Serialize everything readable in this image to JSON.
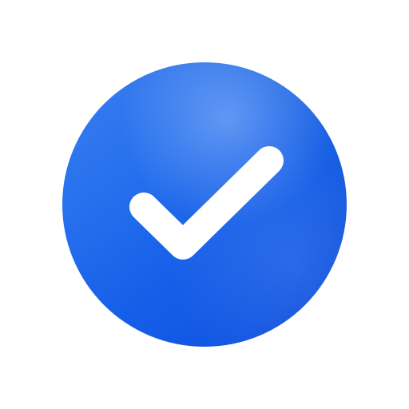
{
  "icon": {
    "name": "check-icon",
    "meaning": "verified / done",
    "badge_color": "#1f67ea",
    "badge_highlight_color": "#4f93f3",
    "check_color": "#ffffff"
  }
}
